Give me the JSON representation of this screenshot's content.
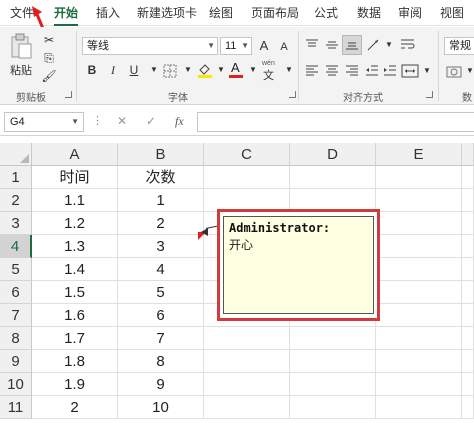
{
  "ribbon_tabs": [
    {
      "label": "文件",
      "active": false
    },
    {
      "label": "开始",
      "active": true
    },
    {
      "label": "插入",
      "active": false
    },
    {
      "label": "新建选项卡",
      "active": false
    },
    {
      "label": "绘图",
      "active": false
    },
    {
      "label": "页面布局",
      "active": false
    },
    {
      "label": "公式",
      "active": false
    },
    {
      "label": "数据",
      "active": false
    },
    {
      "label": "审阅",
      "active": false
    },
    {
      "label": "视图",
      "active": false
    }
  ],
  "ribbon": {
    "clipboard": {
      "paste_label": "粘贴",
      "group_label": "剪贴板"
    },
    "font": {
      "font_name": "等线",
      "font_size": "11",
      "grow": "A",
      "shrink": "A",
      "bold": "B",
      "italic": "I",
      "underline": "U",
      "font_color_glyph": "A",
      "wen_label": "wén",
      "wen_char": "文",
      "group_label": "字体"
    },
    "alignment": {
      "group_label": "对齐方式"
    },
    "number": {
      "format": "常规",
      "group_label": "数"
    }
  },
  "formula_bar": {
    "name_box": "G4",
    "cancel": "✕",
    "enter": "✓",
    "fx": "fx",
    "formula": ""
  },
  "columns": [
    "A",
    "B",
    "C",
    "D",
    "E"
  ],
  "rows": [
    {
      "n": "1",
      "a": "时间",
      "b": "次数"
    },
    {
      "n": "2",
      "a": "1.1",
      "b": "1"
    },
    {
      "n": "3",
      "a": "1.2",
      "b": "2"
    },
    {
      "n": "4",
      "a": "1.3",
      "b": "3"
    },
    {
      "n": "5",
      "a": "1.4",
      "b": "4"
    },
    {
      "n": "6",
      "a": "1.5",
      "b": "5"
    },
    {
      "n": "7",
      "a": "1.6",
      "b": "6"
    },
    {
      "n": "8",
      "a": "1.7",
      "b": "7"
    },
    {
      "n": "9",
      "a": "1.8",
      "b": "8"
    },
    {
      "n": "10",
      "a": "1.9",
      "b": "9"
    },
    {
      "n": "11",
      "a": "2",
      "b": "10"
    }
  ],
  "selected_row": "4",
  "comment": {
    "author": "Administrator:",
    "text": "开心"
  },
  "colors": {
    "accent": "#1e6b3d",
    "highlight": "#d33a3a",
    "comment_bg": "#ffffe1"
  }
}
